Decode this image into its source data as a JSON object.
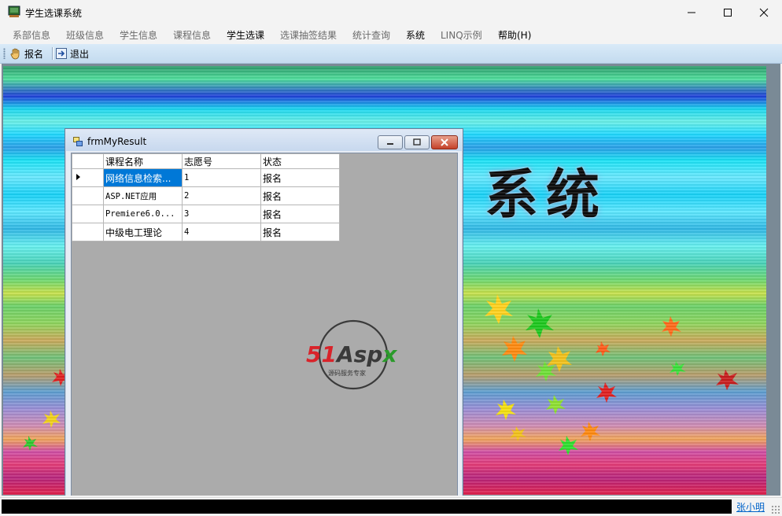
{
  "window": {
    "title": "学生选课系统"
  },
  "menu": {
    "items": [
      {
        "label": "系部信息"
      },
      {
        "label": "班级信息"
      },
      {
        "label": "学生信息"
      },
      {
        "label": "课程信息"
      },
      {
        "label": "学生选课"
      },
      {
        "label": "选课抽签结果"
      },
      {
        "label": "统计查询"
      },
      {
        "label": "系统"
      },
      {
        "label": "LINQ示例"
      },
      {
        "label": "帮助(H)"
      }
    ]
  },
  "toolbar": {
    "register_label": "报名",
    "exit_label": "退出"
  },
  "background": {
    "title_text": "系统"
  },
  "child_window": {
    "title": "frmMyResult",
    "grid": {
      "columns": [
        "课程名称",
        "志愿号",
        "状态"
      ],
      "rows": [
        {
          "course": "网络信息检索...",
          "choice": "1",
          "status": "报名"
        },
        {
          "course": "ASP.NET应用",
          "choice": "2",
          "status": "报名"
        },
        {
          "course": "Premiere6.0...",
          "choice": "3",
          "status": "报名"
        },
        {
          "course": "中级电工理论",
          "choice": "4",
          "status": "报名"
        }
      ]
    },
    "watermark": {
      "brand_red": "51",
      "brand_dark": "Asp",
      "brand_green": "x",
      "tagline": "源码服务专家"
    }
  },
  "statusbar": {
    "link_text": "张小明"
  },
  "colors": {
    "selection": "#0078d7",
    "toolbar": "#c3dbef",
    "link": "#0063c9"
  }
}
